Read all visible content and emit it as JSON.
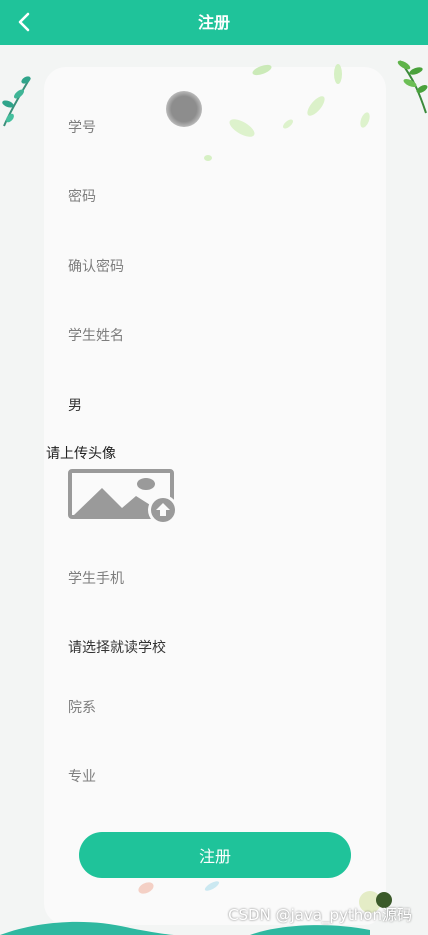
{
  "header": {
    "title": "注册"
  },
  "form": {
    "student_id_placeholder": "学号",
    "password_placeholder": "密码",
    "confirm_password_placeholder": "确认密码",
    "student_name_placeholder": "学生姓名",
    "gender_value": "男",
    "avatar_label": "请上传头像",
    "phone_placeholder": "学生手机",
    "school_select_value": "请选择就读学校",
    "department_placeholder": "院系",
    "major_placeholder": "专业"
  },
  "submit_label": "注册",
  "watermark": "CSDN @java_python源码",
  "colors": {
    "accent": "#1fc39a",
    "background": "#f3f5f4",
    "card": "#fafafa"
  },
  "icons": [
    "chevron-left-icon",
    "image-upload-icon"
  ]
}
